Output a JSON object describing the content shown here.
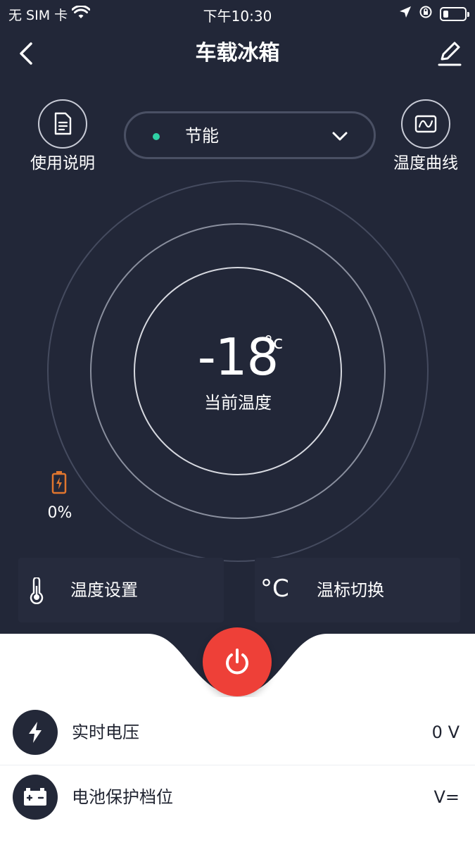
{
  "status_bar": {
    "carrier": "无 SIM 卡",
    "time": "下午10:30",
    "battery_level": 0.25
  },
  "nav": {
    "title": "车载冰箱"
  },
  "top": {
    "manual_label": "使用说明",
    "curve_label": "温度曲线",
    "mode": {
      "label": "节能",
      "dot_color": "#2fd1a5"
    }
  },
  "temperature": {
    "value": "-18",
    "unit": "°c",
    "label": "当前温度"
  },
  "battery": {
    "percent": "0%",
    "color": "#e0762e"
  },
  "cards": {
    "temp_setting": "温度设置",
    "unit_switch_icon": "°C",
    "unit_switch": "温标切换"
  },
  "power": {
    "color": "#ee4038"
  },
  "list": [
    {
      "icon": "lightning-icon",
      "label": "实时电压",
      "value": "0 V"
    },
    {
      "icon": "car-battery-icon",
      "label": "电池保护档位",
      "value": "V="
    }
  ],
  "colors": {
    "dark_bg": "#222738",
    "card_bg": "#262b3d",
    "accent_green": "#2fd1a5"
  }
}
